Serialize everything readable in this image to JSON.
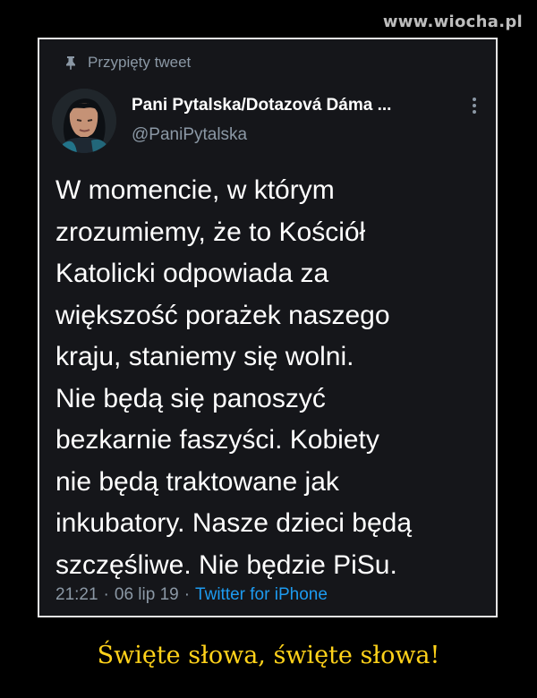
{
  "watermark": "www.wiocha.pl",
  "tweet": {
    "pinned_label": "Przypięty tweet",
    "pin_icon": "pin-icon",
    "author": {
      "display_name": "Pani Pytalska/Dotazová Dáma ...",
      "handle": "@PaniPytalska",
      "avatar_icon": "avatar"
    },
    "more_icon": "more-vertical-icon",
    "text_lines": [
      "W momencie, w którym",
      "zrozumiemy, że to Kościół",
      "Katolicki odpowiada za",
      "większość porażek naszego",
      "kraju, staniemy się wolni.",
      "Nie będą się panoszyć",
      "bezkarnie faszyści. Kobiety",
      "nie będą traktowane jak",
      "inkubatory. Nasze dzieci będą",
      "szczęśliwe. Nie będzie PiSu."
    ],
    "time": "21:21",
    "separator": "·",
    "date": "06 lip 19",
    "source": "Twitter for iPhone"
  },
  "caption": "Święte słowa, święte słowa!",
  "colors": {
    "page_bg": "#000000",
    "card_bg": "#15161a",
    "frame_border": "#e6e6e6",
    "text_primary": "#ffffff",
    "text_secondary": "#8b98a5",
    "link": "#1d9bf0",
    "caption": "#ffd21a"
  }
}
